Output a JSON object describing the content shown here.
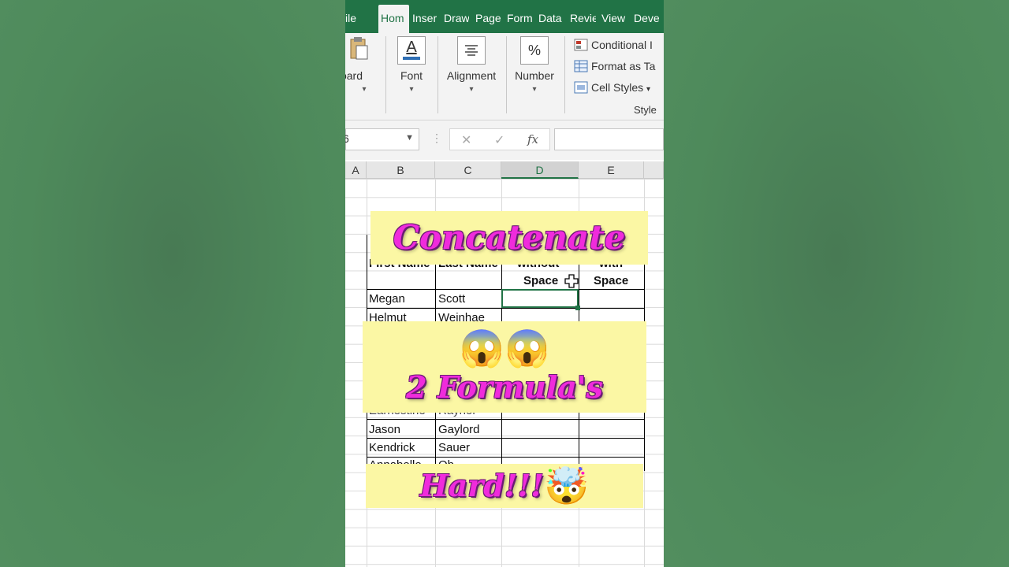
{
  "ribbon_tabs": [
    {
      "label": "ile"
    },
    {
      "label": "Hom",
      "active": true
    },
    {
      "label": "Inser"
    },
    {
      "label": "Draw"
    },
    {
      "label": "Page"
    },
    {
      "label": "Form"
    },
    {
      "label": "Data"
    },
    {
      "label": "Revie"
    },
    {
      "label": "View"
    },
    {
      "label": "Deve"
    }
  ],
  "ribbon_groups": {
    "clipboard": "board",
    "font": "Font",
    "alignment": "Alignment",
    "number": "Number",
    "styles_group": "Style",
    "conditional": "Conditional I",
    "format_table": "Format as Ta",
    "cell_styles": "Cell Styles",
    "percent_symbol": "%",
    "font_symbol": "A"
  },
  "formula_bar": {
    "namebox_value": "6",
    "fx": "fx",
    "cancel": "✕",
    "enter": "✓",
    "dots": "⋮"
  },
  "columns": [
    "A",
    "B",
    "C",
    "D",
    "E"
  ],
  "selected_column": "D",
  "table": {
    "hdr_first": "First Name",
    "hdr_last": "Last Name",
    "hdr_without_1": "without",
    "hdr_without_2": "Space",
    "hdr_with_1": "with",
    "hdr_with_2": "Space",
    "rows": [
      {
        "first": "Megan",
        "last": "Scott"
      },
      {
        "first": "Helmut",
        "last": "Weinhae"
      },
      {
        "first": "Earnestine",
        "last": "Raynor"
      },
      {
        "first": "Jason",
        "last": "Gaylord"
      },
      {
        "first": "Kendrick",
        "last": "Sauer"
      },
      {
        "first": "Annabelle",
        "last": "Ob"
      }
    ]
  },
  "overlay": {
    "title": "Concatenate",
    "emoji_scream": "😱😱",
    "subtitle": "2 Formula's",
    "hard": "Hard!!!",
    "emoji_mindblown": "🤯"
  },
  "colors": {
    "excel_green": "#217346",
    "banner_yellow": "#fbf7a4",
    "text_pink": "#f02bdc",
    "background_green": "#4b8559"
  }
}
